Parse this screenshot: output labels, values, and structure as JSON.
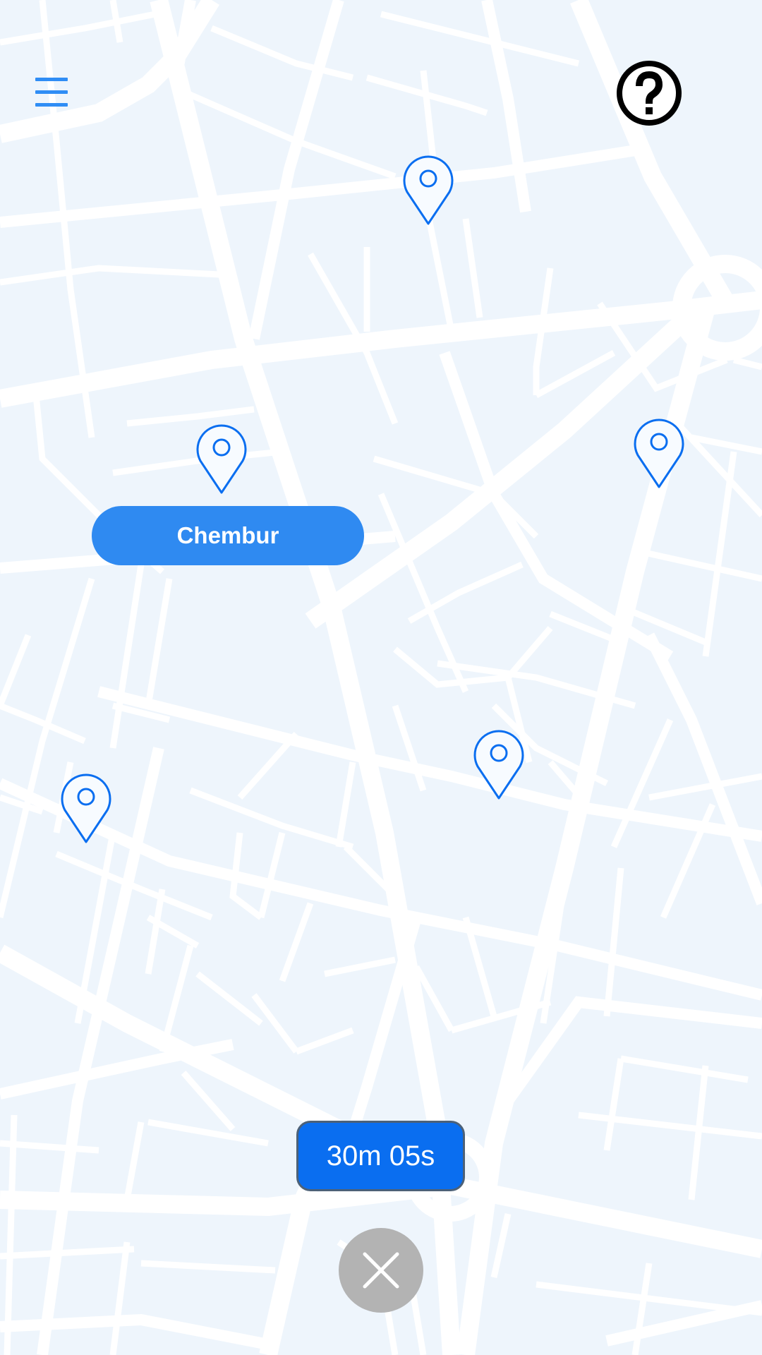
{
  "map": {
    "background_color": "#eef5fc",
    "road_color": "#ffffff"
  },
  "header": {
    "menu_icon": "hamburger-menu-icon",
    "help_icon": "question-circle-icon"
  },
  "pins": [
    {
      "icon": "map-pin-icon"
    },
    {
      "icon": "map-pin-icon"
    },
    {
      "icon": "map-pin-icon"
    },
    {
      "icon": "map-pin-icon"
    },
    {
      "icon": "map-pin-icon"
    }
  ],
  "place_label": {
    "text": "Chembur",
    "color": "#2f8af1"
  },
  "timer": {
    "text": "30m 05s",
    "color": "#0a6ef0"
  },
  "close": {
    "icon": "close-icon",
    "color": "#b3b3b3"
  },
  "colors": {
    "accent": "#2f8df5",
    "pin_stroke": "#0a6ef0"
  }
}
